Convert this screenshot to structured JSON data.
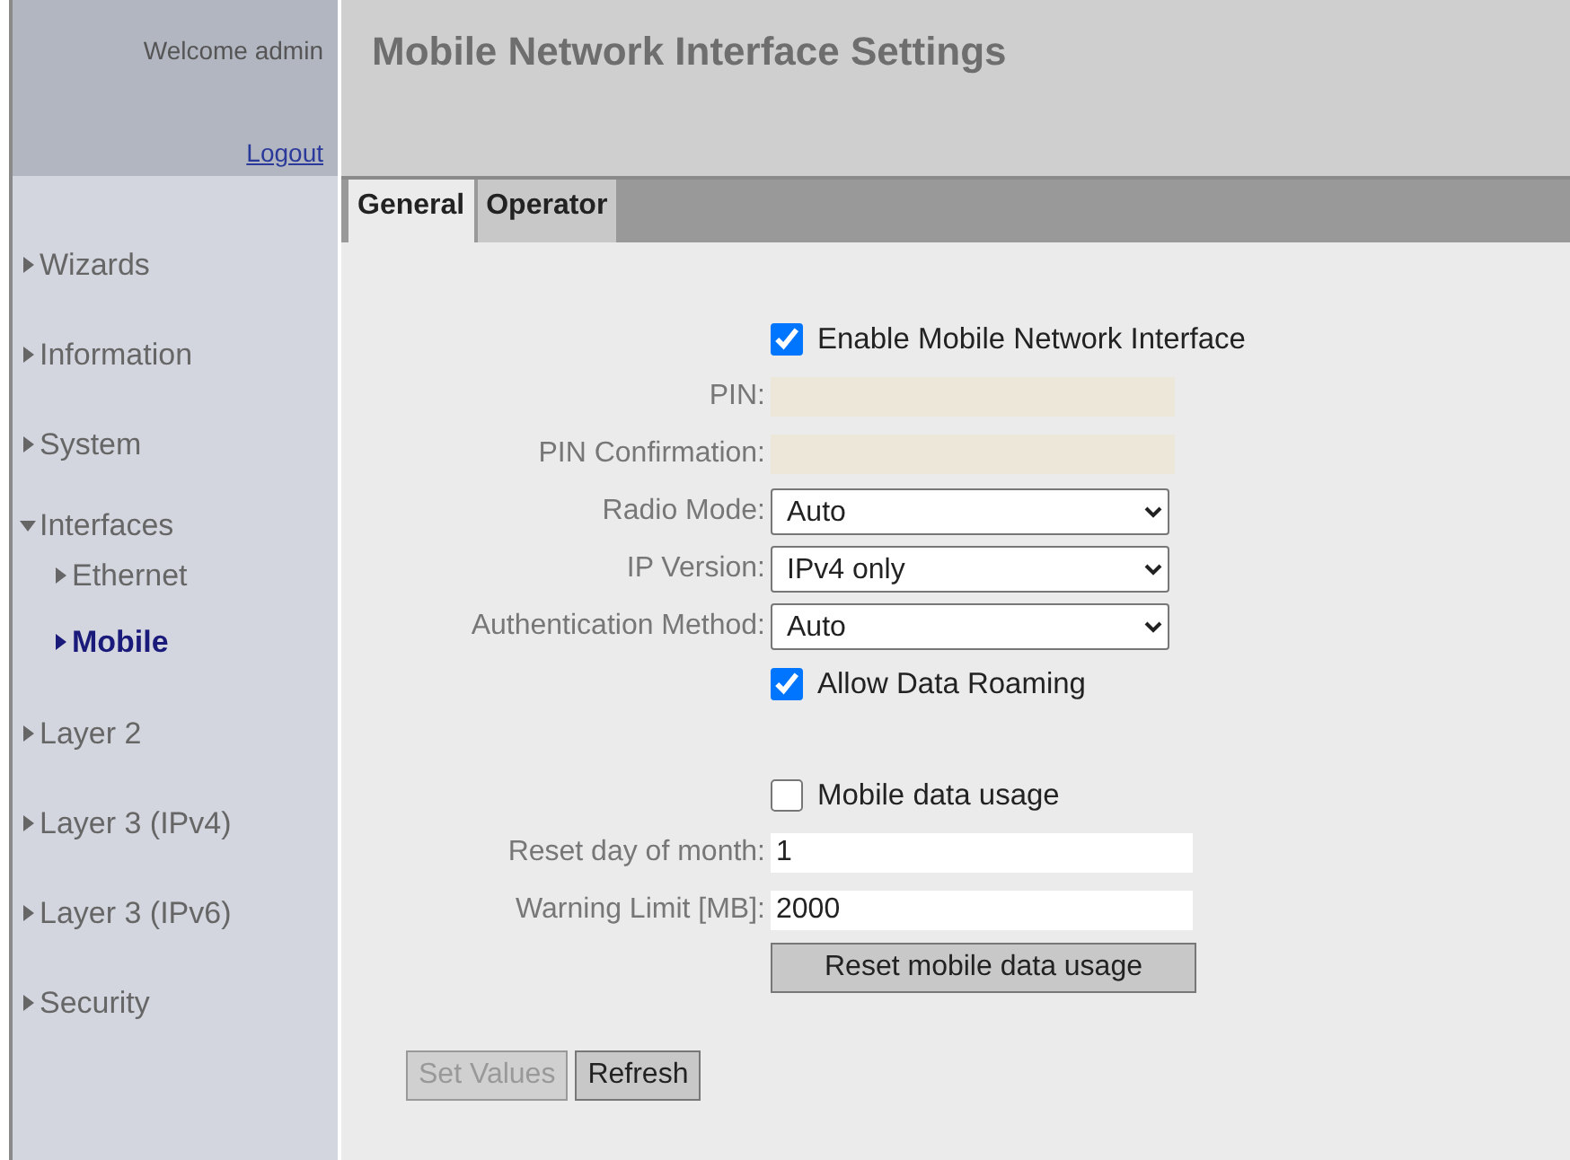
{
  "header": {
    "welcome": "Welcome admin",
    "logout": "Logout"
  },
  "sidebar": {
    "items": [
      {
        "label": "Wizards",
        "expanded": false
      },
      {
        "label": "Information",
        "expanded": false
      },
      {
        "label": "System",
        "expanded": false
      },
      {
        "label": "Interfaces",
        "expanded": true,
        "children": [
          {
            "label": "Ethernet",
            "selected": false
          },
          {
            "label": "Mobile",
            "selected": true
          }
        ]
      },
      {
        "label": "Layer 2",
        "expanded": false
      },
      {
        "label": "Layer 3 (IPv4)",
        "expanded": false
      },
      {
        "label": "Layer 3 (IPv6)",
        "expanded": false
      },
      {
        "label": "Security",
        "expanded": false
      }
    ]
  },
  "page_title": "Mobile Network Interface Settings",
  "tabs": [
    {
      "label": "General",
      "selected": true
    },
    {
      "label": "Operator",
      "selected": false
    }
  ],
  "form": {
    "sections": [
      [
        {
          "kind": "checkbox",
          "label": "Enable Mobile Network Interface",
          "checked": true
        },
        {
          "kind": "text",
          "label": "PIN:",
          "disabled": true
        },
        {
          "kind": "text",
          "label": "PIN Confirmation:",
          "disabled": true
        },
        {
          "kind": "select",
          "label": "Radio Mode:",
          "value": "Auto"
        },
        {
          "kind": "select",
          "label": "IP Version:",
          "value": "IPv4 only"
        },
        {
          "kind": "select",
          "label": "Authentication Method:",
          "value": "Auto"
        },
        {
          "kind": "checkbox",
          "label": "Allow Data Roaming",
          "checked": true
        }
      ],
      [
        {
          "kind": "checkbox",
          "label": "Mobile data usage",
          "checked": false
        },
        {
          "kind": "text",
          "label": "Reset day of month:",
          "value": "1",
          "disabled": false
        },
        {
          "kind": "text",
          "label": "Warning Limit [MB]:",
          "value": "2000",
          "disabled": false
        },
        {
          "kind": "button",
          "label": "Reset mobile data usage"
        }
      ]
    ]
  },
  "buttons": [
    {
      "label": "Set Values",
      "disabled": true
    },
    {
      "label": "Refresh",
      "disabled": false
    }
  ]
}
